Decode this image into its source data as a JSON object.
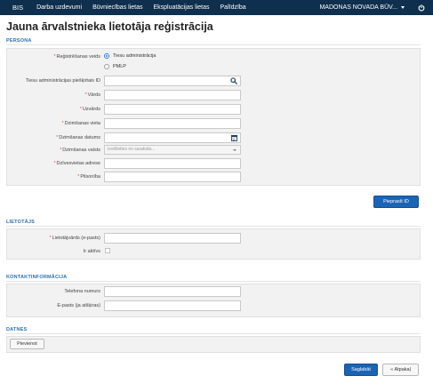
{
  "nav": {
    "brand": "BIS",
    "items": [
      "Darba uzdevumi",
      "Būvniecības lietas",
      "Ekspluatācijas lietas",
      "Palīdzība"
    ],
    "org": "MADONAS NOVADA BŪV..."
  },
  "page": {
    "title": "Jauna ārvalstnieka lietotāja reģistrācija"
  },
  "persona": {
    "section_title": "PERSONA",
    "reg_label": "Reģistrēšanas veids",
    "reg_options": [
      "Tiesu administrācija",
      "PMLP"
    ],
    "id_label": "Tiesu administrācijas piešķirtais ID",
    "vards_label": "Vārds",
    "uzvards_label": "Uzvārds",
    "dzim_vieta_label": "Dzimšanas vieta",
    "dzim_datums_label": "Dzimšanas datums",
    "dzim_valsts_label": "Dzimšanas valsts",
    "dzim_valsts_placeholder": "Izvēlieties no saraksta...",
    "dzives_adrese_label": "Dzīvesvietas adrese",
    "pilsoniba_label": "Pilsonība"
  },
  "pieprasit_button": "Pieprasīt ID",
  "lietotajs": {
    "section_title": "LIETOTĀJS",
    "lietotajvards_label": "Lietotājvārds (e-pasts)",
    "aktivs_label": "Ir aktīvs"
  },
  "kontakt": {
    "section_title": "KONTAKTINFORMĀCIJA",
    "telefons_label": "Telefona numurs",
    "epasts_label": "E-pasts (ja atšķiras)"
  },
  "datnes": {
    "section_title": "DATNES",
    "pievienot_button": "Pievienot"
  },
  "footer": {
    "save_button": "Saglabāt",
    "back_button": "« Atpakaļ"
  }
}
